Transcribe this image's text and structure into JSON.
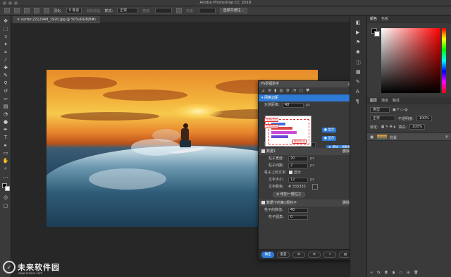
{
  "window": {
    "title": "Adobe Photoshop CC 2018"
  },
  "options_bar": {
    "feather_label": "羽化:",
    "feather_value": "0 像素",
    "antialias_label": "消除锯齿",
    "style_label": "样式:",
    "style_value": "正常",
    "width_label": "宽度:",
    "height_label": "高度:",
    "select_mask_button": "选择并遮住..."
  },
  "document_tab": {
    "label": "surfer-2212948_1920.jpg @ 50%(RGB/8#)"
  },
  "plugin_panel": {
    "title": "PS祝福助手",
    "section_grid": "网格边距",
    "left_margin_label": "左侧距离:",
    "left_margin_value": "40",
    "left_margin_unit": "px",
    "popup_label_red": "左侧边距",
    "popup_label_red2": "左侧距离",
    "popup_label_bottom": "底部距离",
    "show_label_1": "显示",
    "show_label_2": "显示",
    "add_label": "增加一组数据",
    "range_label": "数据范围:",
    "range_min": "0",
    "range_sep": "~",
    "range_max": "100",
    "data_section": "数据1",
    "delete_label": "删除",
    "bar_width_label": "柱子宽度:",
    "bar_width_value": "20",
    "bar_gap_label": "柱子间距:",
    "bar_gap_value": "2",
    "text_label": "柱子上的文字:",
    "text_show": "显示",
    "font_size_label": "文字大小:",
    "font_size_value": "12",
    "text_color_label": "文字颜色:",
    "text_color_value": "# 333333",
    "add_bar_button": "增加一根柱子",
    "data_section2": "数据下的第1根柱子",
    "delete_label2": "删除",
    "bar_value_label": "柱子的数值:",
    "bar_value": "40",
    "bar_radius_label": "柱子圆角:",
    "bar_radius_value": "0",
    "footer": {
      "confirm": "确定",
      "reset": "重置"
    },
    "unit_px": "px"
  },
  "right_panel": {
    "tabs": [
      "颜色",
      "色板"
    ],
    "layers_tabs": [
      "图层",
      "通道",
      "路径"
    ],
    "kind_label": "类型",
    "blend_mode": "正常",
    "opacity_label": "不透明度:",
    "opacity_value": "100%",
    "lock_label": "锁定:",
    "fill_label": "填充:",
    "fill_value": "100%",
    "layer_name": "背景"
  },
  "watermark": {
    "text": "未来软件园",
    "url": "www.orsoon.com"
  },
  "colors": {
    "accent": "#2e7bd6",
    "canvas": "#272727",
    "panel": "#3a3a3a"
  }
}
